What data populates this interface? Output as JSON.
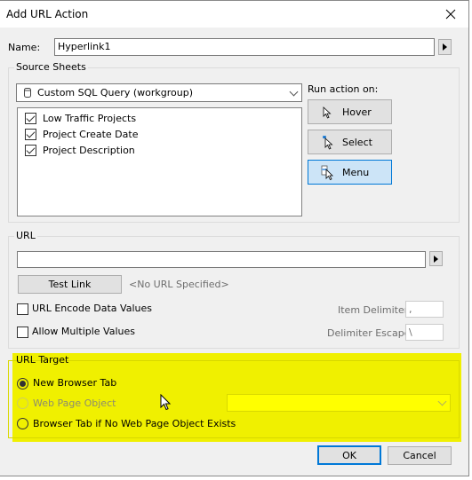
{
  "window": {
    "title": "Add URL Action",
    "close_icon": "close-icon"
  },
  "name_field": {
    "label": "Name:",
    "value": "Hyperlink1"
  },
  "source_sheets": {
    "title": "Source Sheets",
    "datasource": {
      "icon": "database-icon",
      "value": "Custom SQL Query (workgroup)"
    },
    "sheets": [
      {
        "label": "Low Traffic Projects",
        "checked": true
      },
      {
        "label": "Project Create Date",
        "checked": true
      },
      {
        "label": "Project Description",
        "checked": true
      }
    ],
    "run_action_on": {
      "label": "Run action on:",
      "options": [
        {
          "label": "Hover",
          "icon": "pointer-icon",
          "selected": false
        },
        {
          "label": "Select",
          "icon": "select-pointer-icon",
          "selected": false
        },
        {
          "label": "Menu",
          "icon": "menu-pointer-icon",
          "selected": true
        }
      ]
    }
  },
  "url": {
    "title": "URL",
    "value": "",
    "test_link_label": "Test Link",
    "status": "<No URL Specified>",
    "encode_label": "URL Encode Data Values",
    "encode_checked": false,
    "multiple_label": "Allow Multiple Values",
    "multiple_checked": false,
    "item_delimiter_label": "Item Delimiter:",
    "item_delimiter_value": ",",
    "delimiter_escape_label": "Delimiter Escape:",
    "delimiter_escape_value": "\\"
  },
  "url_target": {
    "title": "URL Target",
    "options": [
      {
        "label": "New Browser Tab",
        "selected": true,
        "enabled": true
      },
      {
        "label": "Web Page Object",
        "selected": false,
        "enabled": false
      },
      {
        "label": "Browser Tab if No Web Page Object Exists",
        "selected": false,
        "enabled": true
      }
    ],
    "web_page_object_value": "",
    "highlight_color": "#f0f000"
  },
  "footer": {
    "ok_label": "OK",
    "cancel_label": "Cancel"
  }
}
